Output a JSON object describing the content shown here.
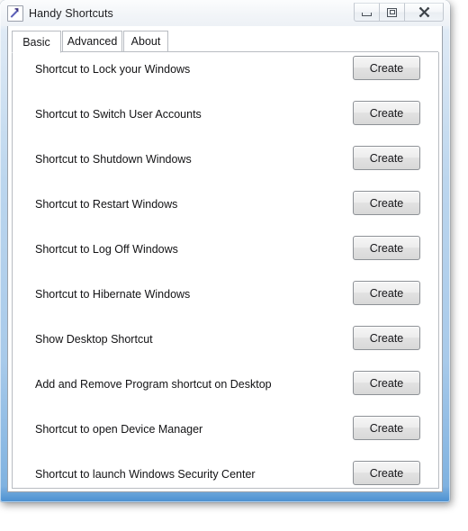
{
  "window": {
    "title": "Handy Shortcuts",
    "icon": "shortcut-arrow-icon",
    "controls": {
      "minimize": "Minimize",
      "maximize": "Maximize",
      "close": "Close"
    },
    "frame_color": "#4a8fd0"
  },
  "tabs": [
    {
      "label": "Basic",
      "active": true
    },
    {
      "label": "Advanced",
      "active": false
    },
    {
      "label": "About",
      "active": false
    }
  ],
  "shortcuts": [
    {
      "label": "Shortcut to Lock your Windows",
      "action": "Create"
    },
    {
      "label": "Shortcut to Switch User Accounts",
      "action": "Create"
    },
    {
      "label": "Shortcut to Shutdown Windows",
      "action": "Create"
    },
    {
      "label": "Shortcut to Restart Windows",
      "action": "Create"
    },
    {
      "label": "Shortcut to Log Off Windows",
      "action": "Create"
    },
    {
      "label": "Shortcut to Hibernate Windows",
      "action": "Create"
    },
    {
      "label": "Show Desktop Shortcut",
      "action": "Create"
    },
    {
      "label": "Add and Remove Program shortcut on Desktop",
      "action": "Create"
    },
    {
      "label": "Shortcut to open Device Manager",
      "action": "Create"
    },
    {
      "label": "Shortcut to launch Windows Security Center",
      "action": "Create"
    }
  ]
}
